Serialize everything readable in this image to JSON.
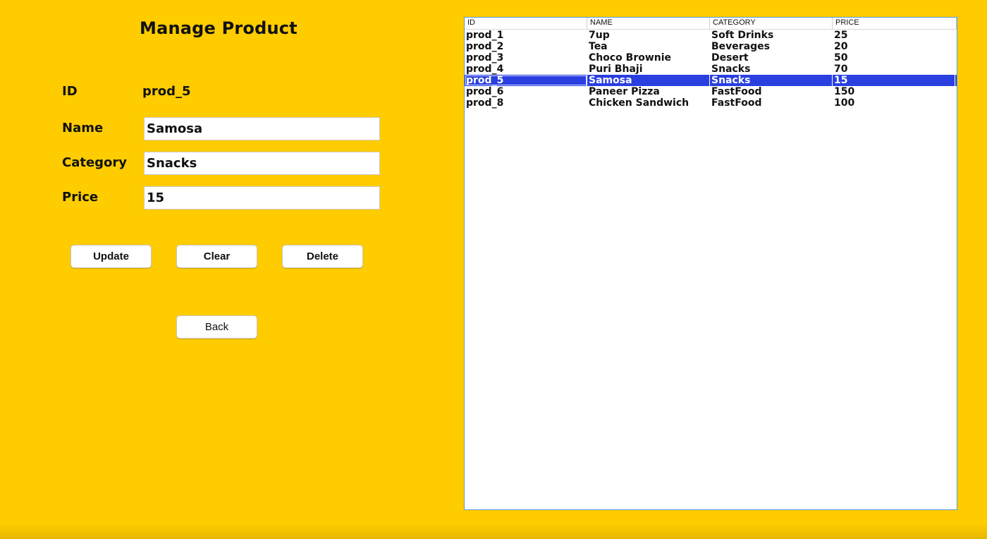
{
  "form": {
    "title": "Manage Product",
    "id_label": "ID",
    "id_value": "prod_5",
    "name_label": "Name",
    "name_value": "Samosa",
    "category_label": "Category",
    "category_value": "Snacks",
    "price_label": "Price",
    "price_value": "15"
  },
  "buttons": {
    "update": "Update",
    "clear": "Clear",
    "delete": "Delete",
    "back": "Back"
  },
  "table": {
    "headers": [
      "ID",
      "NAME",
      "CATEGORY",
      "PRICE"
    ],
    "rows": [
      [
        "prod_1",
        "7up",
        "Soft Drinks",
        "25"
      ],
      [
        "prod_2",
        "Tea",
        "Beverages",
        "20"
      ],
      [
        "prod_3",
        "Choco Brownie",
        "Desert",
        "50"
      ],
      [
        "prod_4",
        "Puri Bhaji",
        "Snacks",
        "70"
      ],
      [
        "prod_5",
        "Samosa",
        "Snacks",
        "15"
      ],
      [
        "prod_6",
        "Paneer Pizza",
        "FastFood",
        "150"
      ],
      [
        "prod_8",
        "Chicken Sandwich",
        "FastFood",
        "100"
      ]
    ],
    "selected_row": 4
  },
  "colors": {
    "background": "#ffcc00",
    "selection": "#2a3fe0",
    "table_border": "#5a9bd8"
  }
}
